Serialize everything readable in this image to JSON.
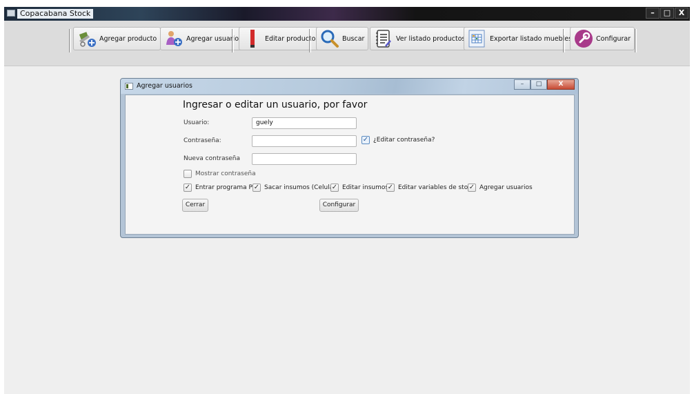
{
  "window": {
    "title": "Copacabana Stock",
    "controls": {
      "minimize": "–",
      "maximize": "□",
      "close": "X"
    }
  },
  "toolbar": {
    "buttons": [
      {
        "label": "Agregar producto",
        "icon": "cart-add-icon"
      },
      {
        "label": "Agregar usuario",
        "icon": "user-add-icon"
      },
      {
        "label": "Editar producto",
        "icon": "pencil-icon"
      },
      {
        "label": "Buscar",
        "icon": "magnifier-icon"
      },
      {
        "label": "Ver listado productos",
        "icon": "list-icon"
      },
      {
        "label": "Exportar listado muebles",
        "icon": "spreadsheet-icon"
      },
      {
        "label": "Configurar",
        "icon": "wrench-icon"
      }
    ]
  },
  "dialog": {
    "title": "Agregar usuarios",
    "heading": "Ingresar o editar un usuario, por favor",
    "usuario_label": "Usuario:",
    "usuario_value": "guely",
    "contrasena_label": "Contraseña:",
    "contrasena_value": "",
    "editar_contrasena_label": "¿Editar contraseña?",
    "editar_contrasena_checked": true,
    "nueva_contrasena_label": "Nueva contraseña",
    "nueva_contrasena_value": "",
    "mostrar_contrasena_label": "Mostrar contraseña",
    "mostrar_contrasena_checked": false,
    "permissions": [
      {
        "label": "Entrar programa PC",
        "checked": true
      },
      {
        "label": "Sacar insumos (Celular)",
        "checked": true
      },
      {
        "label": "Editar insumos",
        "checked": true
      },
      {
        "label": "Editar variables de stock",
        "checked": true
      },
      {
        "label": "Agregar usuarios",
        "checked": true
      }
    ],
    "cerrar_label": "Cerrar",
    "configurar_label": "Configurar"
  }
}
